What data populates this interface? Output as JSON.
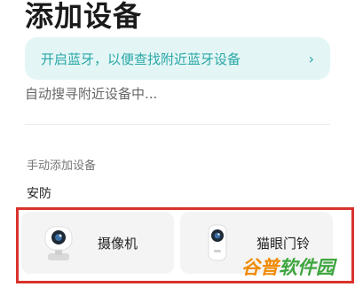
{
  "page": {
    "title": "添加设备"
  },
  "bluetooth_banner": {
    "text": "开启蓝牙，以便查找附近蓝牙设备",
    "chevron_icon": "chevron-right-icon"
  },
  "search_status": "自动搜寻附近设备中...",
  "manual_section": {
    "title": "手动添加设备",
    "category": "安防",
    "devices": [
      {
        "label": "摄像机",
        "icon": "camera-icon"
      },
      {
        "label": "猫眼门铃",
        "icon": "peephole-doorbell-icon"
      }
    ]
  },
  "watermark": {
    "part1": "谷普",
    "part2": "软件园"
  },
  "colors": {
    "accent": "#2aa7a7",
    "banner_bg": "#e3f6f5",
    "highlight": "#d9322c",
    "card_bg": "#f4f4f4"
  }
}
